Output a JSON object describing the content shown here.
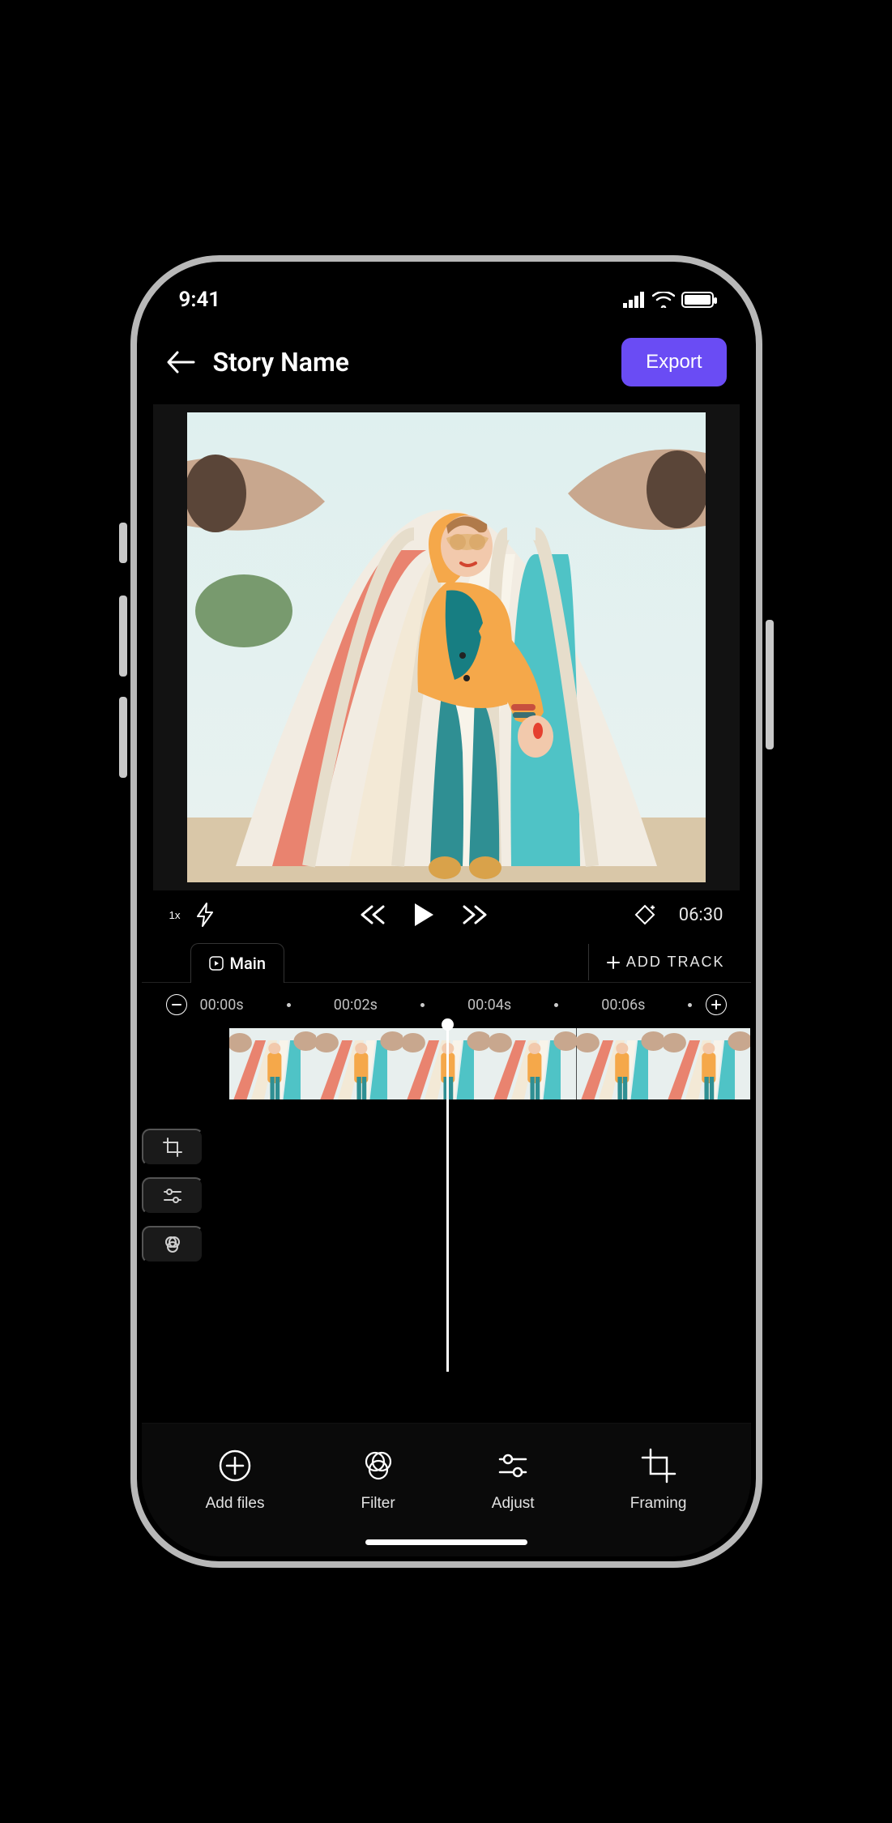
{
  "status": {
    "time": "9:41"
  },
  "header": {
    "title": "Story Name",
    "export": "Export"
  },
  "playback": {
    "speed": "1x",
    "duration": "06:30"
  },
  "tabs": {
    "main": "Main",
    "add_track": "ADD TRACK"
  },
  "ruler": {
    "marks": [
      "00:00s",
      "00:02s",
      "00:04s",
      "00:06s"
    ]
  },
  "bottom": {
    "add_files": "Add files",
    "filter": "Filter",
    "adjust": "Adjust",
    "framing": "Framing"
  },
  "colors": {
    "accent": "#6a4cf4"
  }
}
